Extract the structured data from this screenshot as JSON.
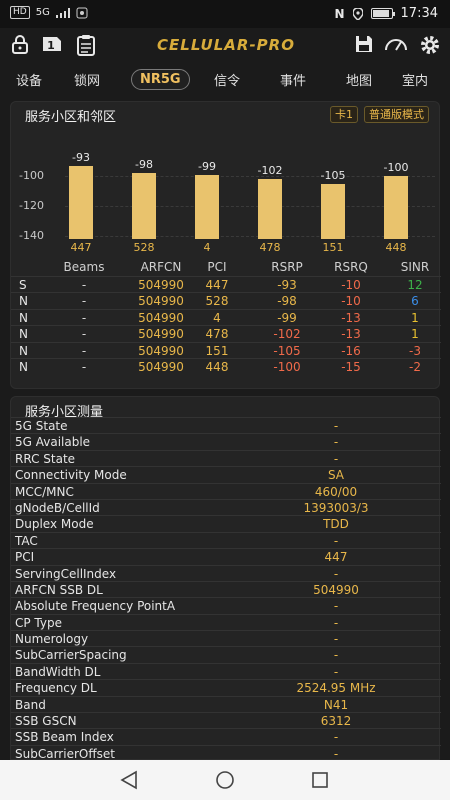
{
  "status_bar": {
    "left_chips": [
      "HD",
      "5G"
    ],
    "time": "17:34"
  },
  "app": {
    "logo": "CELLULAR-PRO",
    "sim_badge": "1"
  },
  "tabs": [
    {
      "label": "设备",
      "active": false
    },
    {
      "label": "锁网",
      "active": false
    },
    {
      "label": "NR5G",
      "active": true
    },
    {
      "label": "信令",
      "active": false
    },
    {
      "label": "事件",
      "active": false
    },
    {
      "label": "地图",
      "active": false
    },
    {
      "label": "室内",
      "active": false
    }
  ],
  "cell_panel": {
    "title": "服务小区和邻区",
    "chips": [
      "卡1",
      "普通版模式"
    ]
  },
  "chart_data": {
    "type": "bar",
    "categories": [
      "447",
      "528",
      "4",
      "478",
      "151",
      "448"
    ],
    "values": [
      -93,
      -98,
      -99,
      -102,
      -105,
      -100
    ],
    "y_ticks": [
      -100,
      -120,
      -140
    ],
    "ylim": [
      -142,
      -80
    ],
    "bar_color": "#e9c36d"
  },
  "neighbor_table": {
    "headers": [
      "",
      "Beams",
      "ARFCN",
      "PCI",
      "RSRP",
      "RSRQ",
      "SINR"
    ],
    "rows": [
      {
        "type": "S",
        "beams": "-",
        "arfcn": "504990",
        "pci": "447",
        "rsrp": "-93",
        "rsrq": "-10",
        "sinr": "12",
        "rsrp_color": "#e8b74a",
        "rsrq_color": "#f06a4a",
        "sinr_color": "#3db24a"
      },
      {
        "type": "N",
        "beams": "-",
        "arfcn": "504990",
        "pci": "528",
        "rsrp": "-98",
        "rsrq": "-10",
        "sinr": "6",
        "rsrp_color": "#e8b74a",
        "rsrq_color": "#f06a4a",
        "sinr_color": "#3b8ee8"
      },
      {
        "type": "N",
        "beams": "-",
        "arfcn": "504990",
        "pci": "4",
        "rsrp": "-99",
        "rsrq": "-13",
        "sinr": "1",
        "rsrp_color": "#e8b74a",
        "rsrq_color": "#f06a4a",
        "sinr_color": "#e8c030"
      },
      {
        "type": "N",
        "beams": "-",
        "arfcn": "504990",
        "pci": "478",
        "rsrp": "-102",
        "rsrq": "-13",
        "sinr": "1",
        "rsrp_color": "#f06a4a",
        "rsrq_color": "#f06a4a",
        "sinr_color": "#e8c030"
      },
      {
        "type": "N",
        "beams": "-",
        "arfcn": "504990",
        "pci": "151",
        "rsrp": "-105",
        "rsrq": "-16",
        "sinr": "-3",
        "rsrp_color": "#f06a4a",
        "rsrq_color": "#f06a4a",
        "sinr_color": "#f06a4a"
      },
      {
        "type": "N",
        "beams": "-",
        "arfcn": "504990",
        "pci": "448",
        "rsrp": "-100",
        "rsrq": "-15",
        "sinr": "-2",
        "rsrp_color": "#f06a4a",
        "rsrq_color": "#f06a4a",
        "sinr_color": "#f06a4a"
      }
    ]
  },
  "measure_panel": {
    "title": "服务小区测量",
    "rows": [
      {
        "key": "5G State",
        "value": "-"
      },
      {
        "key": "5G Available",
        "value": "-"
      },
      {
        "key": "RRC State",
        "value": "-"
      },
      {
        "key": "Connectivity Mode",
        "value": "SA"
      },
      {
        "key": "MCC/MNC",
        "value": "460/00"
      },
      {
        "key": "gNodeB/CellId",
        "value": "1393003/3"
      },
      {
        "key": "Duplex Mode",
        "value": "TDD"
      },
      {
        "key": "TAC",
        "value": "-"
      },
      {
        "key": "PCI",
        "value": "447"
      },
      {
        "key": "ServingCellIndex",
        "value": "-"
      },
      {
        "key": "ARFCN SSB DL",
        "value": "504990"
      },
      {
        "key": "Absolute Frequency PointA",
        "value": "-"
      },
      {
        "key": "CP Type",
        "value": "-"
      },
      {
        "key": "Numerology",
        "value": "-"
      },
      {
        "key": "SubCarrierSpacing",
        "value": "-"
      },
      {
        "key": "BandWidth DL",
        "value": "-"
      },
      {
        "key": "Frequency DL",
        "value": "2524.95 MHz"
      },
      {
        "key": "Band",
        "value": "N41"
      },
      {
        "key": "SSB GSCN",
        "value": "6312"
      },
      {
        "key": "SSB Beam Index",
        "value": "-"
      },
      {
        "key": "SubCarrierOffset",
        "value": "-"
      }
    ]
  }
}
